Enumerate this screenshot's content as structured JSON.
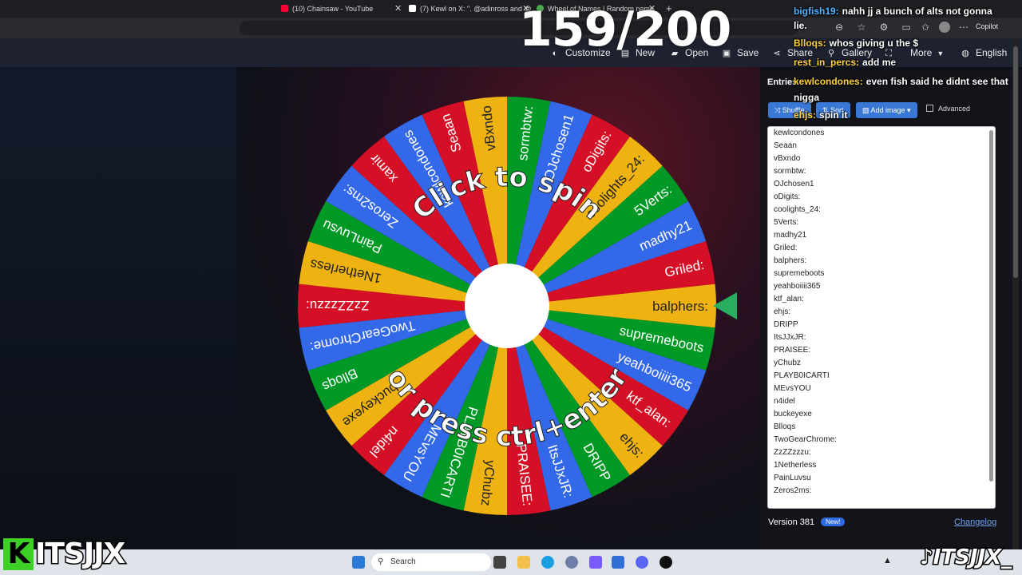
{
  "overlay": {
    "counter": "159/200",
    "chat": [
      {
        "user": "bigfish19:",
        "user_color": "#4fb3ff",
        "text": "nahh jj a bunch of alts not gonna"
      },
      {
        "user": "",
        "user_color": "#ffffff",
        "text": "lie."
      },
      {
        "user": "Blloqs:",
        "user_color": "#ffd23a",
        "text": "whos giving u the $"
      },
      {
        "user": "rest_in_percs:",
        "user_color": "#ffd23a",
        "text": "add me"
      },
      {
        "user": "kewlcondones:",
        "user_color": "#ffd23a",
        "text": "even fish said he didnt see that"
      },
      {
        "user": "",
        "user_color": "#ffffff",
        "text": "nigga"
      },
      {
        "user": "ehjs:",
        "user_color": "#ffd23a",
        "text": "spin it"
      }
    ],
    "logo_left": "ITSJJX",
    "logo_left_k": "K",
    "logo_right": "ITSJJX_"
  },
  "browser": {
    "tabs": [
      {
        "label": "(10) Chainsaw - YouTube",
        "fav_color": "#ff0033"
      },
      {
        "label": "(7) Kewl on X: \". @adinross and @",
        "fav_color": "#ffffff"
      },
      {
        "label": "Wheel of Names | Random name",
        "fav_color": "#4caf50"
      }
    ],
    "copilot_label": "Copilot"
  },
  "header": {
    "customize": "Customize",
    "new": "New",
    "open": "Open",
    "save": "Save",
    "share": "Share",
    "gallery": "Gallery",
    "more": "More",
    "language": "English"
  },
  "wheel": {
    "center_text_top": "Click to spin",
    "center_text_bottom": "or press ctrl+enter",
    "colors": [
      "#3369e8",
      "#d50f25",
      "#eeb211",
      "#009925"
    ],
    "segments": [
      "kewlcondones",
      "Seaan",
      "vBxndo",
      "sormbtw:",
      "OJchosen1",
      "oDigits:",
      "coolights_24:",
      "5Verts:",
      "madhy21",
      "Griled:",
      "balphers:",
      "supremeboots",
      "yeahboiiii365",
      "ktf_alan:",
      "ehjs:",
      "DRIPP",
      "ItsJJxJR:",
      "PRAISEE:",
      "yChubz",
      "PLAYB0ICARTI",
      "MEvsYOU",
      "n4idel",
      "buckeyexe",
      "Blloqs",
      "TwoGearChrome:",
      "ZzZZzzzu:",
      "1Netherless",
      "PainLuvsu",
      "Zeros2ms:",
      "xamir"
    ]
  },
  "panel": {
    "tab_entries": "Entries",
    "shuffle": "Shuffle",
    "sort": "Sort",
    "add_image": "Add image",
    "advanced": "Advanced",
    "entries": [
      "kewlcondones",
      "Seaan",
      "vBxndo",
      "sormbtw:",
      "OJchosen1",
      "oDigits:",
      "coolights_24:",
      "5Verts:",
      "madhy21",
      "Griled:",
      "balphers:",
      "supremeboots",
      "yeahboiiii365",
      "ktf_alan:",
      "ehjs:",
      "DRIPP",
      "ItsJJxJR:",
      "PRAISEE:",
      "yChubz",
      "PLAYB0ICARTI",
      "MEvsYOU",
      "n4idel",
      "buckeyexe",
      "Blloqs",
      "TwoGearChrome:",
      "ZzZZzzzu:",
      "1Netherless",
      "PainLuvsu",
      "Zeros2ms:"
    ],
    "version": "Version 381",
    "new_badge": "New!",
    "changelog": "Changelog"
  },
  "taskbar": {
    "search_label": "Search"
  }
}
